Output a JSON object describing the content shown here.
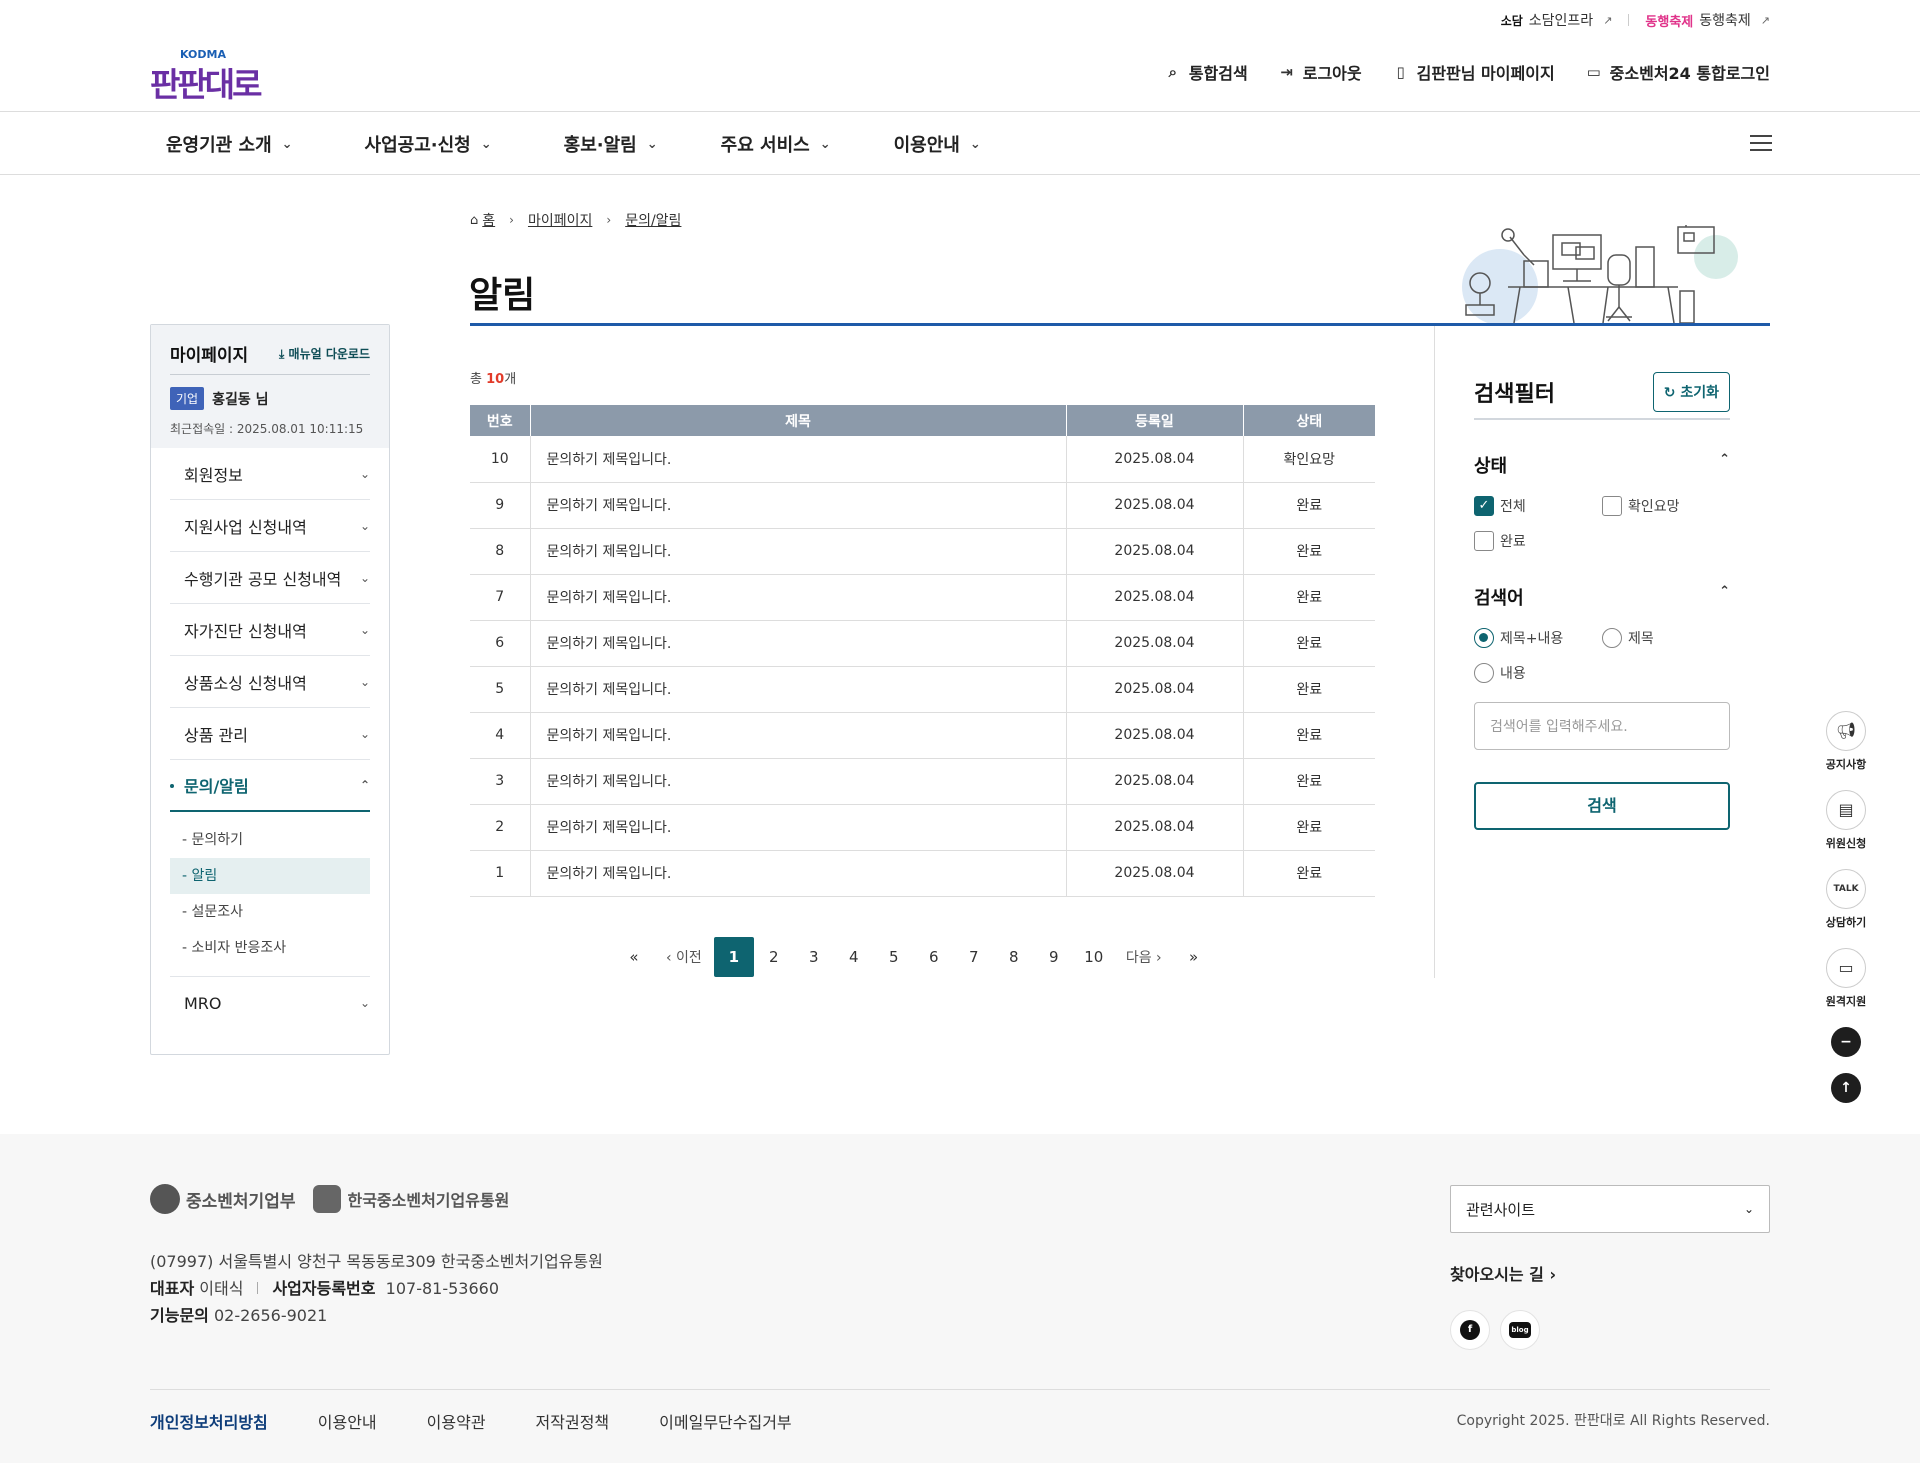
{
  "util": {
    "sodam_logo": "소담",
    "sodam": "소담인프라",
    "festival_logo": "동행축제",
    "festival": "동행축제"
  },
  "header": {
    "logo_main": "판판대로",
    "logo_sub": "KODMA",
    "nav": [
      {
        "label": "통합검색",
        "icon": "search-icon"
      },
      {
        "label": "로그아웃",
        "icon": "logout-icon"
      },
      {
        "label": "김판판님 마이페이지",
        "icon": "book-icon"
      },
      {
        "label": "중소벤처24 통합로그인",
        "icon": "id-card-icon"
      }
    ]
  },
  "gnb": [
    "운영기관 소개",
    "사업공고·신청",
    "홍보·알림",
    "주요 서비스",
    "이용안내"
  ],
  "sidebar": {
    "title": "마이페이지",
    "manual": "매뉴얼 다운로드",
    "badge": "기업",
    "user": "홍길동 님",
    "last_login": "최근접속일 : 2025.08.01 10:11:15",
    "menu": [
      "회원정보",
      "지원사업 신청내역",
      "수행기관 공모 신청내역",
      "자가진단 신청내역",
      "상품소싱 신청내역",
      "상품 관리"
    ],
    "active": "문의/알림",
    "sub": [
      "- 문의하기",
      "- 알림",
      "- 설문조사",
      "- 소비자 반응조사"
    ],
    "last_item": "MRO"
  },
  "breadcrumb": [
    "홈",
    "마이페이지",
    "문의/알림"
  ],
  "page_title": "알림",
  "total": {
    "prefix": "총 ",
    "count": "10",
    "suffix": "개"
  },
  "table": {
    "headers": [
      "번호",
      "제목",
      "등록일",
      "상태"
    ],
    "rows": [
      [
        "10",
        "문의하기 제목입니다.",
        "2025.08.04",
        "확인요망"
      ],
      [
        "9",
        "문의하기 제목입니다.",
        "2025.08.04",
        "완료"
      ],
      [
        "8",
        "문의하기 제목입니다.",
        "2025.08.04",
        "완료"
      ],
      [
        "7",
        "문의하기 제목입니다.",
        "2025.08.04",
        "완료"
      ],
      [
        "6",
        "문의하기 제목입니다.",
        "2025.08.04",
        "완료"
      ],
      [
        "5",
        "문의하기 제목입니다.",
        "2025.08.04",
        "완료"
      ],
      [
        "4",
        "문의하기 제목입니다.",
        "2025.08.04",
        "완료"
      ],
      [
        "3",
        "문의하기 제목입니다.",
        "2025.08.04",
        "완료"
      ],
      [
        "2",
        "문의하기 제목입니다.",
        "2025.08.04",
        "완료"
      ],
      [
        "1",
        "문의하기 제목입니다.",
        "2025.08.04",
        "완료"
      ]
    ]
  },
  "pagination": {
    "first": "«",
    "prev": "‹ 이전",
    "pages": [
      "1",
      "2",
      "3",
      "4",
      "5",
      "6",
      "7",
      "8",
      "9",
      "10"
    ],
    "current": "1",
    "next": "다음 ›",
    "last": "»"
  },
  "filter": {
    "title": "검색필터",
    "reset": "초기화",
    "status_title": "상태",
    "status_opts": [
      {
        "label": "전체",
        "checked": true
      },
      {
        "label": "확인요망",
        "checked": false
      },
      {
        "label": "완료",
        "checked": false
      }
    ],
    "keyword_title": "검색어",
    "keyword_opts": [
      {
        "label": "제목+내용",
        "checked": true
      },
      {
        "label": "제목",
        "checked": false
      },
      {
        "label": "내용",
        "checked": false
      }
    ],
    "placeholder": "검색어를 입력해주세요.",
    "search": "검색"
  },
  "quick": [
    "공지사항",
    "위원신청",
    "상담하기",
    "원격지원"
  ],
  "quick_icons": [
    "megaphone-icon",
    "clipboard-icon",
    "talk-icon",
    "laptop-icon"
  ],
  "footer": {
    "org1": "중소벤처기업부",
    "org2": "한국중소벤처기업유통원",
    "address": "(07997) 서울특별시 양천구 목동동로309 한국중소벤처기업유통원",
    "rep_label": "대표자",
    "rep": "이태식",
    "biz_label": "사업자등록번호",
    "biz": "107-81-53660",
    "tel_label": "기능문의",
    "tel": "02-2656-9021",
    "related": "관련사이트",
    "way": "찾아오시는 길 ›",
    "sns": [
      "f",
      "blog"
    ],
    "links": [
      "개인정보처리방침",
      "이용안내",
      "이용약관",
      "저작권정책",
      "이메일무단수집거부"
    ],
    "copyright": "Copyright 2025. 판판대로 All Rights Reserved."
  },
  "colors": {
    "accent": "#0e6470",
    "title_line": "#1e5aa8",
    "table_head": "#8c9aaa",
    "count": "#e23b2a"
  }
}
